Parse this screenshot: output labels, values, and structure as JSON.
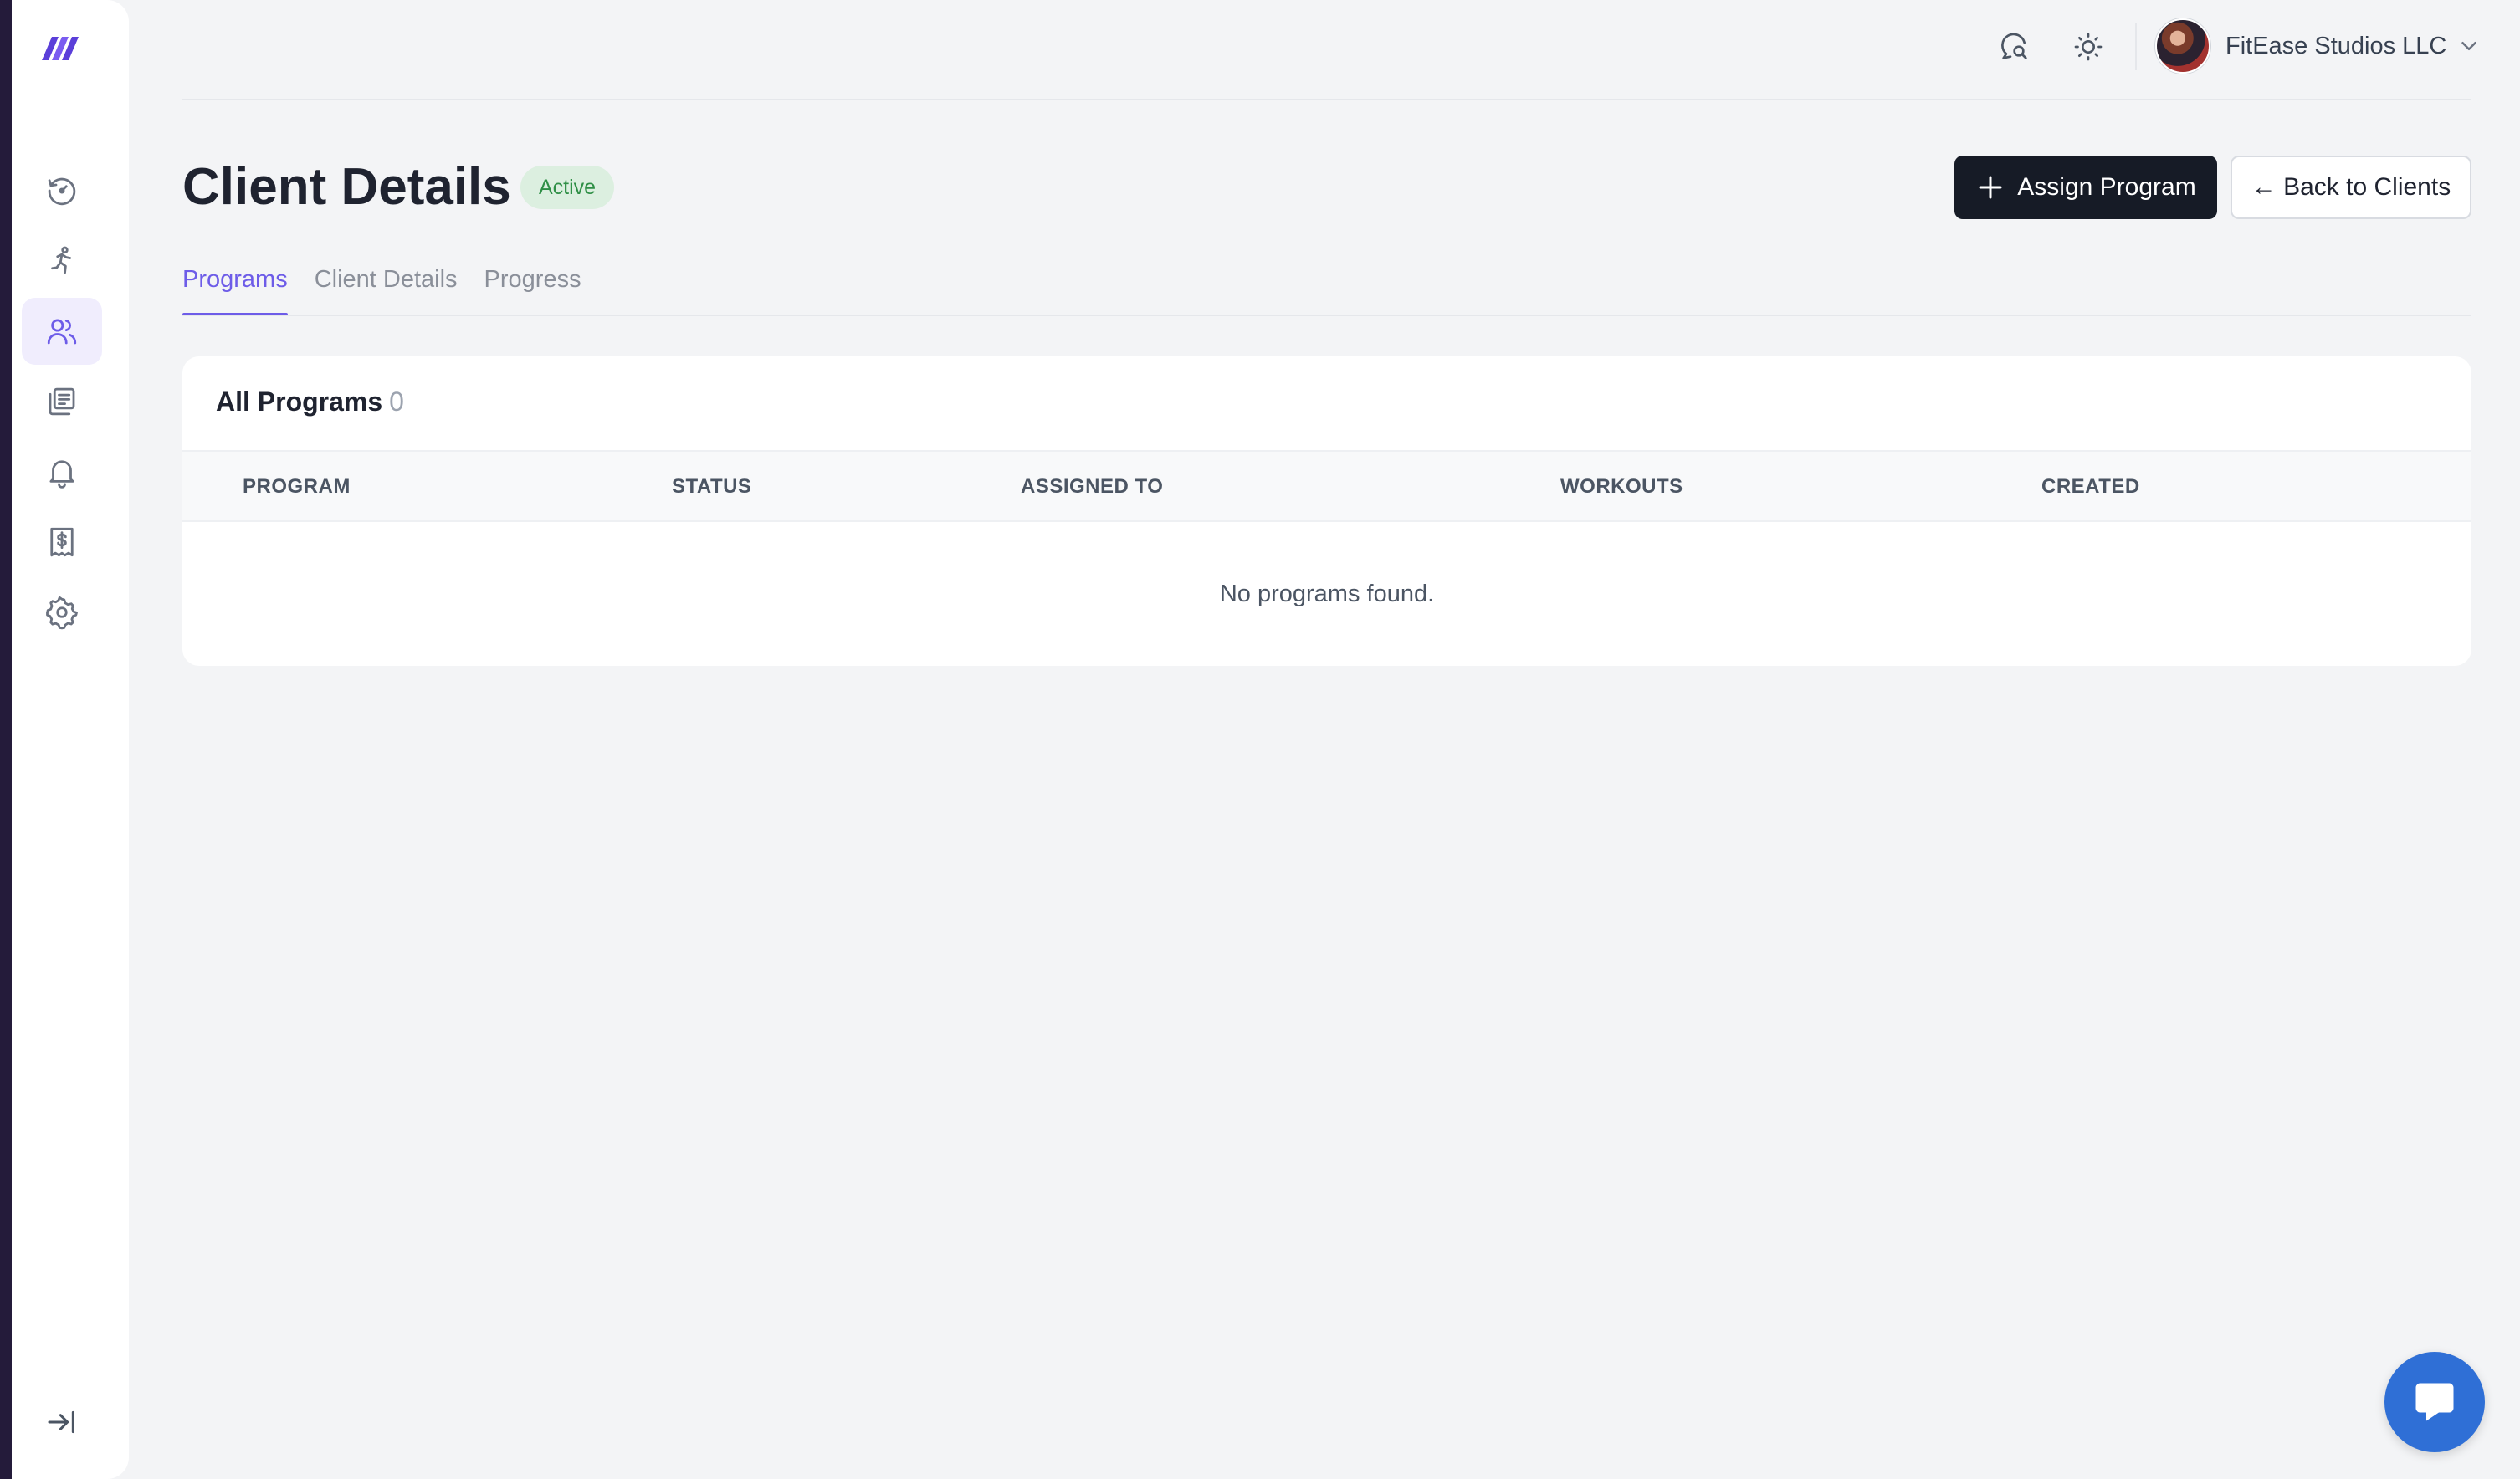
{
  "sidebar": {
    "logo_icon": "brand-logo",
    "items": [
      {
        "name": "dashboard",
        "icon": "gauge-history-icon",
        "active": false
      },
      {
        "name": "workouts",
        "icon": "running-person-icon",
        "active": false
      },
      {
        "name": "clients",
        "icon": "users-icon",
        "active": true
      },
      {
        "name": "programs",
        "icon": "library-icon",
        "active": false
      },
      {
        "name": "notifications",
        "icon": "bell-icon",
        "active": false
      },
      {
        "name": "billing",
        "icon": "receipt-dollar-icon",
        "active": false
      },
      {
        "name": "settings",
        "icon": "gear-icon",
        "active": false
      }
    ],
    "collapse_icon": "expand-sidebar-icon"
  },
  "topbar": {
    "search_icon": "search-chat-icon",
    "theme_icon": "sun-icon",
    "account_name": "FitEase Studios LLC"
  },
  "header": {
    "title": "Client Details",
    "status": "Active",
    "assign_label": "Assign Program",
    "back_label": "← Back to Clients"
  },
  "tabs": [
    {
      "label": "Programs",
      "active": true
    },
    {
      "label": "Client Details",
      "active": false
    },
    {
      "label": "Progress",
      "active": false
    }
  ],
  "programs": {
    "title": "All Programs",
    "count": "0",
    "columns": [
      "PROGRAM",
      "STATUS",
      "ASSIGNED TO",
      "WORKOUTS",
      "CREATED"
    ],
    "empty_message": "No programs found."
  },
  "colors": {
    "accent": "#6d5ce8",
    "primary_button": "#161b26",
    "status_bg": "#dcefe0",
    "status_text": "#2f8f46",
    "chat": "#2f6fd6"
  }
}
